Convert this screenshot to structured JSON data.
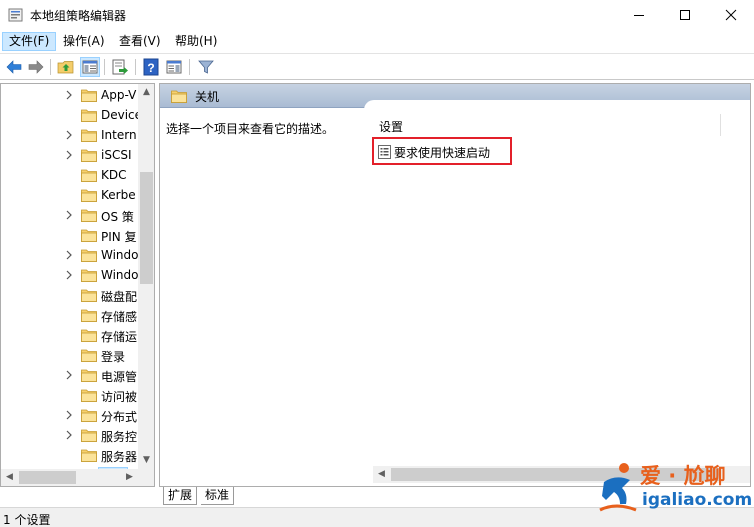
{
  "window": {
    "title": "本地组策略编辑器",
    "controls": [
      "minimize",
      "maximize",
      "close"
    ]
  },
  "menu": [
    "文件(F)",
    "操作(A)",
    "查看(V)",
    "帮助(H)"
  ],
  "toolbar": {
    "buttons": [
      "back-icon",
      "forward-icon",
      "up-folder-icon",
      "show-hide-tree-icon",
      "export-list-icon",
      "help-icon",
      "show-hide-action-pane-icon",
      "filter-icon"
    ]
  },
  "tree": {
    "items": [
      {
        "label": "App-V",
        "expandable": true
      },
      {
        "label": "Device",
        "expandable": false
      },
      {
        "label": "Intern",
        "expandable": true
      },
      {
        "label": "iSCSI",
        "expandable": true
      },
      {
        "label": "KDC",
        "expandable": false
      },
      {
        "label": "Kerbe",
        "expandable": false
      },
      {
        "label": "OS 策",
        "expandable": true
      },
      {
        "label": "PIN 复",
        "expandable": false
      },
      {
        "label": "Windo",
        "expandable": true
      },
      {
        "label": "Windo",
        "expandable": true
      },
      {
        "label": "磁盘配",
        "expandable": false
      },
      {
        "label": "存储感",
        "expandable": false
      },
      {
        "label": "存储运",
        "expandable": false
      },
      {
        "label": "登录",
        "expandable": false
      },
      {
        "label": "电源管",
        "expandable": true
      },
      {
        "label": "访问被",
        "expandable": false
      },
      {
        "label": "分布式",
        "expandable": true
      },
      {
        "label": "服务控",
        "expandable": true
      },
      {
        "label": "服务器",
        "expandable": false
      },
      {
        "label": "关机",
        "expandable": false,
        "selected": true
      }
    ]
  },
  "right_pane": {
    "header_title": "关机",
    "description": "选择一个项目来查看它的描述。",
    "column_header": "设置",
    "settings": [
      {
        "label": "要求使用快速启动",
        "highlighted": true
      }
    ]
  },
  "tabs": [
    {
      "label": "扩展",
      "active": true
    },
    {
      "label": "标准",
      "active": false
    }
  ],
  "status": "1 个设置",
  "watermark": {
    "title": "爱 · 尬聊",
    "url": "igaliao.com"
  },
  "colors": {
    "header_blue": "#b7c6da",
    "highlight_red": "#e3202a",
    "selection": "#cce8ff",
    "watermark_orange": "#e8601c",
    "watermark_blue": "#1b6fc0"
  }
}
